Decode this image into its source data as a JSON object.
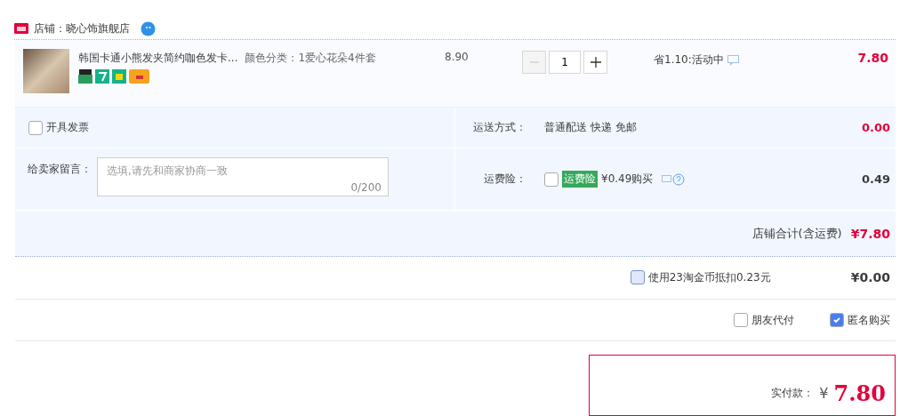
{
  "store": {
    "name": "店铺：晓心饰旗舰店"
  },
  "item": {
    "title": "韩国卡通小熊发夹简约咖色发卡...",
    "sku": "颜色分类：1爱心花朵4件套",
    "price": "8.90",
    "quantity": "1",
    "decrease_disabled": true,
    "promo": "省1.10:活动中",
    "total": "7.80"
  },
  "invoice": {
    "label": "开具发票",
    "checked": false
  },
  "shipping": {
    "label": "运送方式：",
    "value": "普通配送 快递 免邮",
    "price": "0.00"
  },
  "message": {
    "label": "给卖家留言：",
    "placeholder": "选填,请先和商家协商一致",
    "counter": "0/200"
  },
  "insurance": {
    "label": "运费险：",
    "checked": false,
    "badge": "运费险",
    "offer": "¥0.49购买",
    "price": "0.49"
  },
  "store_total": {
    "label": "店铺合计(含运费)",
    "value": "¥7.80"
  },
  "coins": {
    "label": "使用23淘金币抵扣0.23元",
    "checked": false,
    "value": "¥0.00"
  },
  "options": [
    {
      "label": "朋友代付",
      "checked": false
    },
    {
      "label": "匿名购买",
      "checked": true
    }
  ],
  "payment": {
    "label": "实付款：",
    "currency": "¥",
    "amount": "7.80"
  }
}
